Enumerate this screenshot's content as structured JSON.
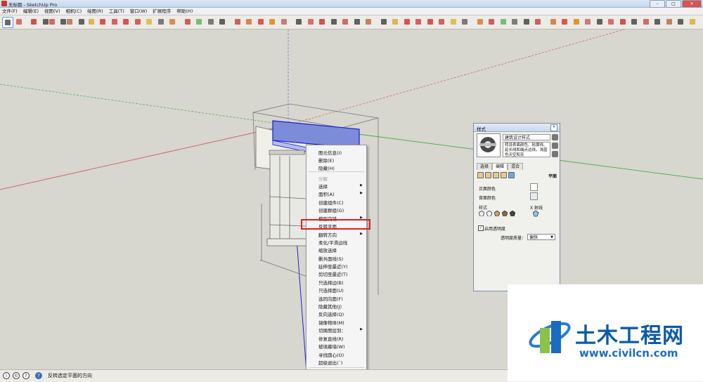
{
  "window": {
    "title": "无标题 - SketchUp Pro"
  },
  "menubar": [
    "文件(F)",
    "编辑(E)",
    "视图(V)",
    "相机(C)",
    "绘图(R)",
    "工具(T)",
    "窗口(W)",
    "扩展程序",
    "帮助(H)"
  ],
  "context_menu": {
    "items": [
      {
        "label": "图元信息(I)",
        "submenu": false,
        "disabled": false
      },
      {
        "label": "删除(E)",
        "submenu": false,
        "disabled": false
      },
      {
        "label": "隐藏(H)",
        "submenu": false,
        "disabled": false
      },
      {
        "label": "分解",
        "submenu": false,
        "disabled": true
      },
      {
        "label": "选择",
        "submenu": true,
        "disabled": false
      },
      {
        "label": "面积(A)",
        "submenu": true,
        "disabled": false
      },
      {
        "label": "创建组件(C)",
        "submenu": false,
        "disabled": false
      },
      {
        "label": "创建群组(G)",
        "submenu": false,
        "disabled": false
      },
      {
        "label": "模型交错",
        "submenu": true,
        "disabled": false
      },
      {
        "label": "反转平面",
        "submenu": false,
        "disabled": false
      },
      {
        "label": "翻转方向",
        "submenu": true,
        "disabled": false
      },
      {
        "label": "柔化/平滑边线",
        "submenu": false,
        "disabled": false
      },
      {
        "label": "缩放选择",
        "submenu": false,
        "disabled": false
      },
      {
        "label": "删共面线(S)",
        "submenu": false,
        "disabled": false
      },
      {
        "label": "延伸至最近(Y)",
        "submenu": false,
        "disabled": false
      },
      {
        "label": "剪切至最近(T)",
        "submenu": false,
        "disabled": false
      },
      {
        "label": "只选择边(B)",
        "submenu": false,
        "disabled": false
      },
      {
        "label": "只选择面(U)",
        "submenu": false,
        "disabled": false
      },
      {
        "label": "选同向面(F)",
        "submenu": false,
        "disabled": false
      },
      {
        "label": "隐藏其他(J)",
        "submenu": false,
        "disabled": false
      },
      {
        "label": "反向选择(Q)",
        "submenu": false,
        "disabled": false
      },
      {
        "label": "镜像物体(M)",
        "submenu": false,
        "disabled": false
      },
      {
        "label": "切换图层到：",
        "submenu": true,
        "disabled": false
      },
      {
        "label": "修复直线(R)",
        "submenu": false,
        "disabled": false
      },
      {
        "label": "玻璃幕墙(W)",
        "submenu": false,
        "disabled": false
      },
      {
        "label": "寻找圆心(O)",
        "submenu": false,
        "disabled": false
      },
      {
        "label": "超级退出(`)",
        "submenu": false,
        "disabled": false
      },
      {
        "label": "添加照片设置",
        "submenu": false,
        "disabled": false
      }
    ]
  },
  "style_panel": {
    "title": "样式",
    "style_name": "建筑设计样式",
    "description": "转设表面颜色、轮廓线、延长线和端点边线，浅蓝色天空和灰",
    "tabs": [
      "选择",
      "编辑",
      "混合"
    ],
    "active_tab": "编辑",
    "sub_title": "平面",
    "front_color_label": "正面颜色",
    "back_color_label": "背面颜色",
    "style_label": "样式",
    "xray_label": "X 射线",
    "transparency_label": "启用透明度",
    "quality_label": "透明度质量：",
    "quality_value": "偏快",
    "front_color": "#ffffff",
    "back_color": "#e6ebf0"
  },
  "status": {
    "text": "反转选定平面的方向"
  },
  "watermark": {
    "cn": "土木工程网",
    "url": "www.civilcn.com"
  }
}
